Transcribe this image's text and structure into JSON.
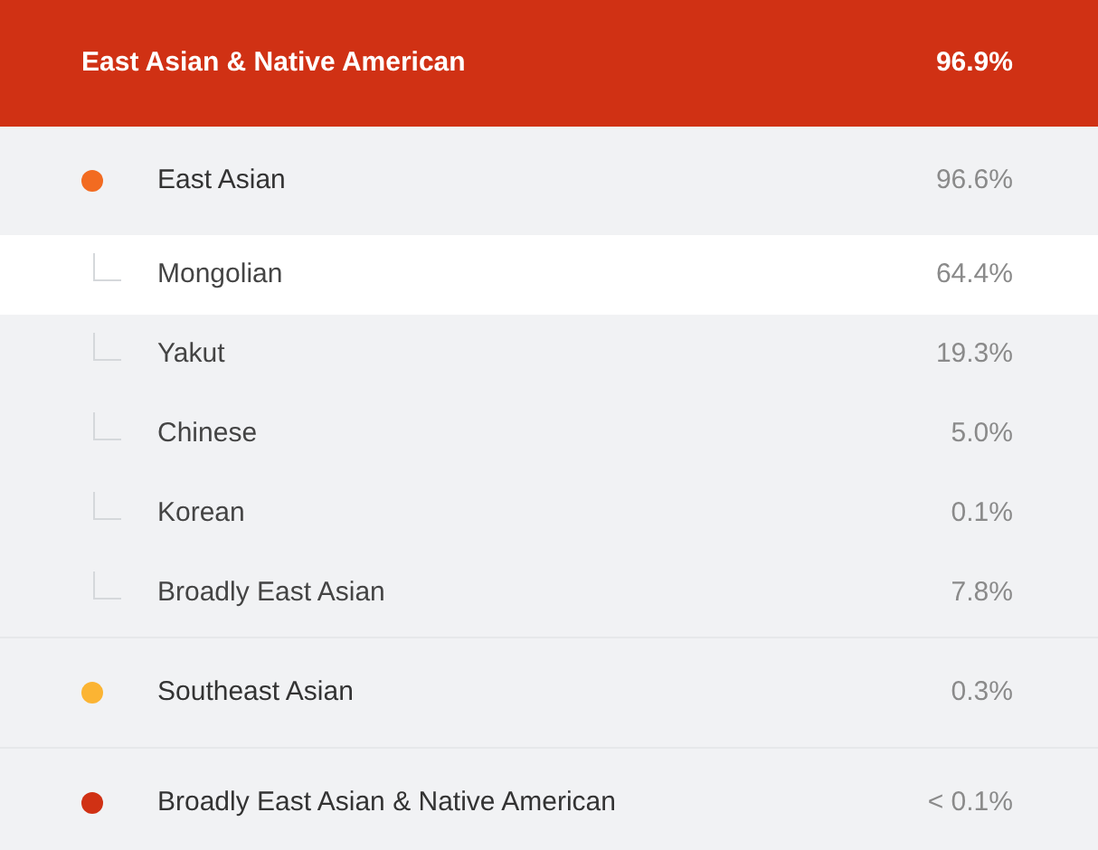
{
  "header": {
    "label": "East Asian & Native American",
    "percent": "96.9%"
  },
  "groups": [
    {
      "name": "East Asian",
      "percent": "96.6%",
      "color": "#f26b21",
      "children": [
        {
          "name": "Mongolian",
          "percent": "64.4%",
          "selected": true
        },
        {
          "name": "Yakut",
          "percent": "19.3%",
          "selected": false
        },
        {
          "name": "Chinese",
          "percent": "5.0%",
          "selected": false
        },
        {
          "name": "Korean",
          "percent": "0.1%",
          "selected": false
        },
        {
          "name": "Broadly East Asian",
          "percent": "7.8%",
          "selected": false
        }
      ]
    },
    {
      "name": "Southeast Asian",
      "percent": "0.3%",
      "color": "#fbb433"
    },
    {
      "name": "Broadly East Asian & Native American",
      "percent": "< 0.1%",
      "color": "#d03114"
    }
  ]
}
